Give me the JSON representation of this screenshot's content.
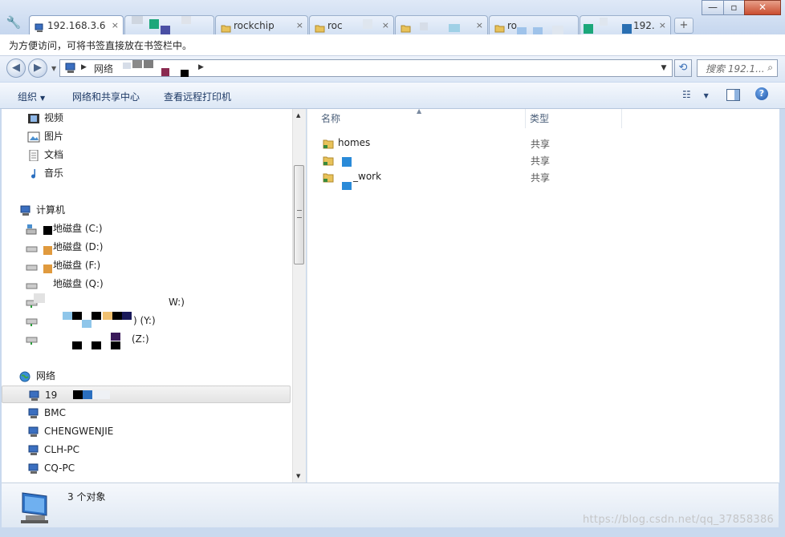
{
  "tabs": [
    {
      "label": "192.168.3.6",
      "active": true
    },
    {
      "label": "",
      "active": false
    },
    {
      "label": "rockchip",
      "active": false
    },
    {
      "label": "roc",
      "active": false
    },
    {
      "label": "",
      "active": false
    },
    {
      "label": "ro",
      "active": false
    },
    {
      "label": "192.",
      "active": false
    }
  ],
  "bookmark_hint": "为方便访问，可将书签直接放在书签栏中。",
  "address": {
    "root": "网络",
    "search_placeholder": "搜索 192.1..."
  },
  "commands": {
    "organize": "组织",
    "network_center": "网络和共享中心",
    "remote_printer": "查看远程打印机"
  },
  "nav": {
    "libraries": [
      "视频",
      "图片",
      "文档",
      "音乐"
    ],
    "computer": "计算机",
    "drives": [
      {
        "label": "地磁盘 (C:)"
      },
      {
        "label": "地磁盘 (D:)"
      },
      {
        "label": "地磁盘 (F:)"
      },
      {
        "label": "地磁盘 (Q:)"
      },
      {
        "label": "W:)"
      },
      {
        "label": ") (Y:)"
      },
      {
        "label": "(Z:)"
      }
    ],
    "network": "网络",
    "hosts": [
      "19",
      "BMC",
      "CHENGWENJIE",
      "CLH-PC",
      "CQ-PC"
    ]
  },
  "columns": {
    "name": "名称",
    "type": "类型"
  },
  "files": [
    {
      "name": "homes",
      "type": "共享"
    },
    {
      "name": "",
      "type": "共享"
    },
    {
      "name": "_work",
      "type": "共享"
    }
  ],
  "status": {
    "count": "3 个对象"
  },
  "watermark": "https://blog.csdn.net/qq_37858386",
  "colors": {
    "accent": "#3a6fb7",
    "selected": "#e3e3e3",
    "window_frame": "#c9d9ee"
  }
}
